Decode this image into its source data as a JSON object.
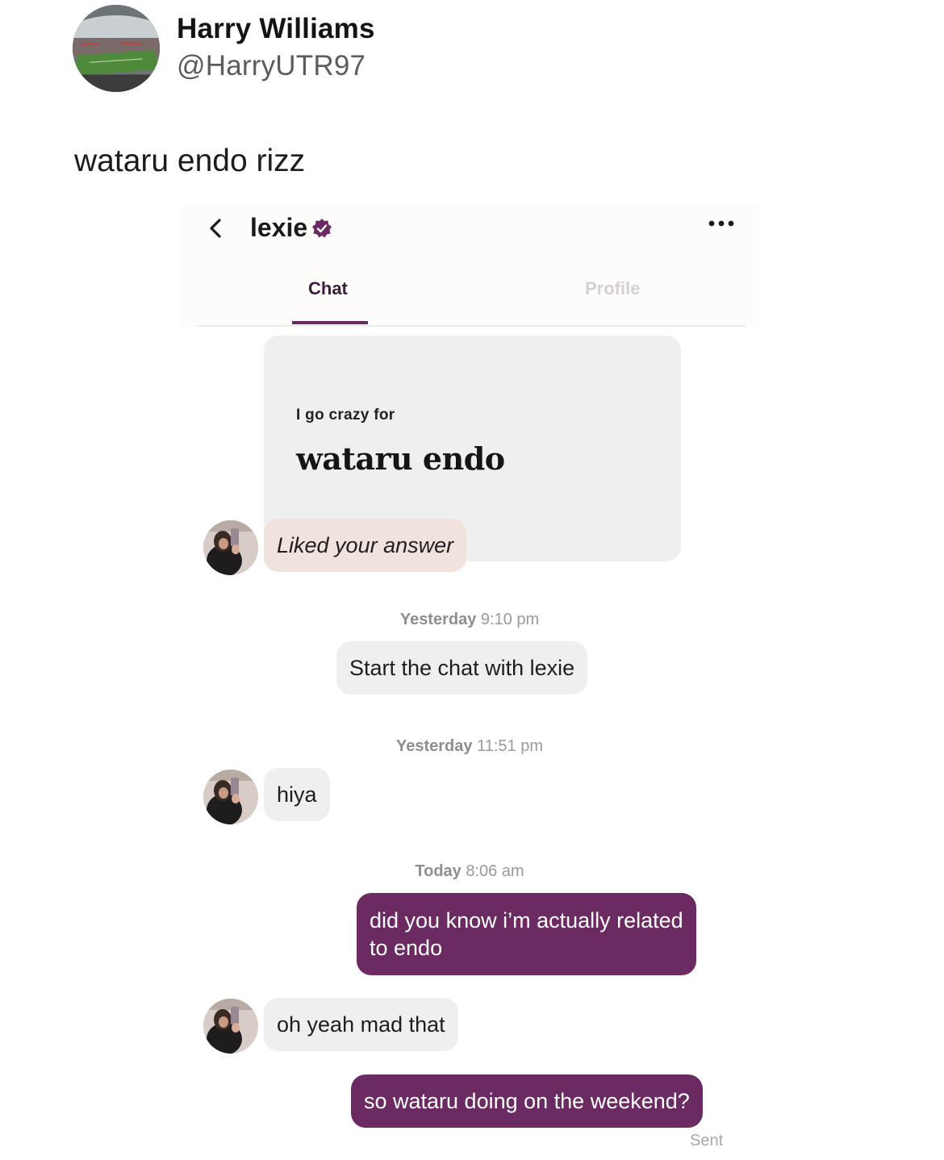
{
  "tweet": {
    "author_name": "Harry Williams",
    "author_handle": "@HarryUTR97",
    "text": "wataru endo rizz"
  },
  "chat_header": {
    "contact_name": "lexie",
    "tabs": [
      {
        "label": "Chat",
        "active": true
      },
      {
        "label": "Profile",
        "active": false
      }
    ]
  },
  "prompt_card": {
    "label": "I go crazy for",
    "answer": "wataru endo"
  },
  "messages": [
    {
      "type": "liked",
      "text": "Liked your answer"
    },
    {
      "type": "timestamp",
      "day": "Yesterday",
      "time": "9:10 pm"
    },
    {
      "type": "system",
      "text": "Start the chat with lexie"
    },
    {
      "type": "timestamp",
      "day": "Yesterday",
      "time": "11:51 pm"
    },
    {
      "type": "incoming",
      "text": "hiya"
    },
    {
      "type": "timestamp",
      "day": "Today",
      "time": "8:06 am"
    },
    {
      "type": "outgoing",
      "lines": [
        "did you know i’m actually related",
        "to endo"
      ]
    },
    {
      "type": "incoming",
      "text": "oh yeah mad that"
    },
    {
      "type": "outgoing",
      "text": "so wataru doing on the weekend?"
    }
  ],
  "status": {
    "sent_label": "Sent"
  },
  "colors": {
    "accent": "#6b2a62",
    "incoming_bubble": "#efefef",
    "liked_bubble": "#f0e3de",
    "timestamp": "#9a9a9a"
  },
  "icons": {
    "back": "chevron-left-icon",
    "verified": "verified-badge-icon",
    "more": "more-options-icon"
  }
}
